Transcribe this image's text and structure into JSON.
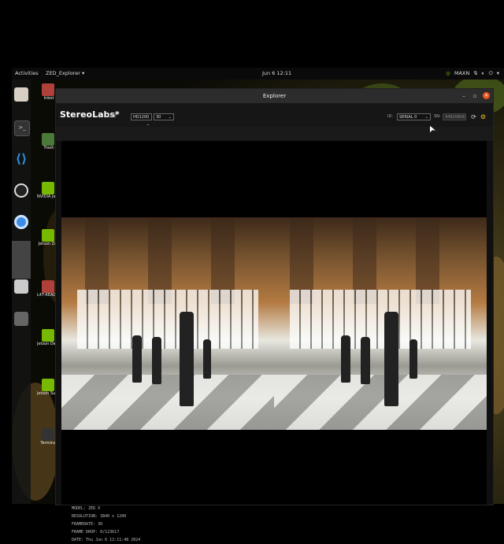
{
  "topbar": {
    "activities": "Activities",
    "app_menu": "ZED_Explorer ▾",
    "clock": "Jun 6 12:11",
    "power_mode": "MAXN"
  },
  "desktop_icons": [
    {
      "label": "Inbot"
    },
    {
      "label": "Trash"
    },
    {
      "label": "NVIDIA Jets Community"
    },
    {
      "label": "Jetson Zoo"
    },
    {
      "label": "L4T-README"
    },
    {
      "label": "Jetson Developer Z"
    },
    {
      "label": "Jetson Supp Forums"
    },
    {
      "label": "Terminal"
    }
  ],
  "window": {
    "title": "Explorer"
  },
  "toolbar": {
    "brand": "StereoLabs*",
    "live_label": "LIVE",
    "resolution_value": "HD1200",
    "fps_value": "30",
    "id_label": "ID:",
    "id_value": "SERIAL 0",
    "sn_label": "SN:",
    "sn_value": "44920806"
  },
  "camera_info": {
    "model": "MODEL: ZED X",
    "resolution": "RESOLUTION: 3840 x 1200",
    "framerate": "FRAMERATE: 30",
    "frame_drop": "FRAME DROP: 0/123617",
    "date": "DATE: Thu Jun 6 12:11:48 2024"
  },
  "colors": {
    "accent_close": "#e95420",
    "window_bg": "#101010"
  }
}
